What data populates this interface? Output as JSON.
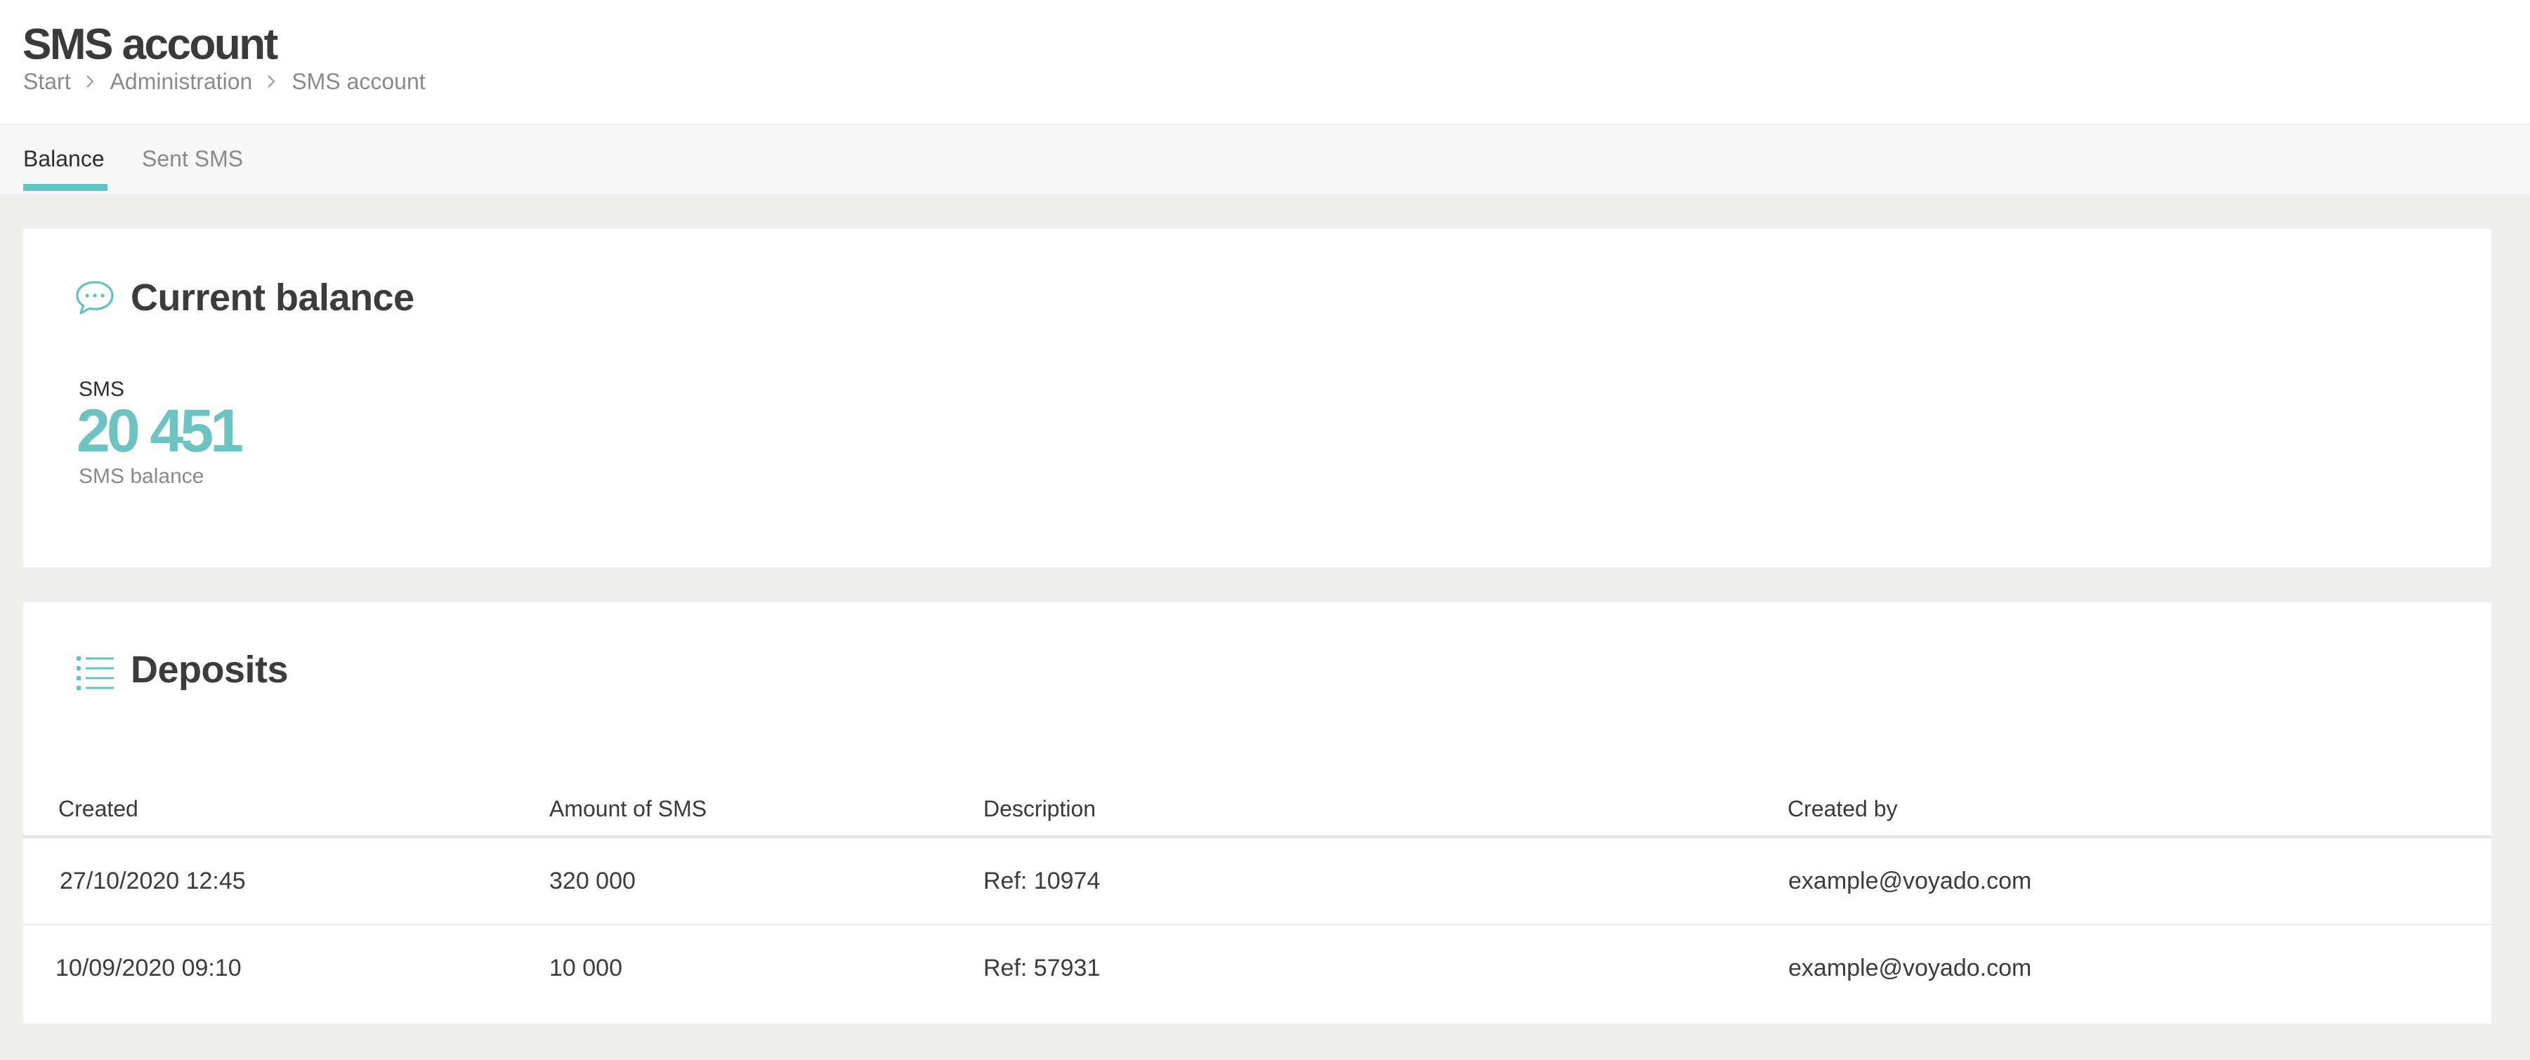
{
  "header": {
    "title": "SMS account",
    "breadcrumb": [
      "Start",
      "Administration",
      "SMS account"
    ]
  },
  "tabs": [
    {
      "label": "Balance",
      "active": true
    },
    {
      "label": "Sent SMS",
      "active": false
    }
  ],
  "balance_card": {
    "title": "Current balance",
    "icon": "chat-bubble-icon",
    "label": "SMS",
    "value": "20 451",
    "sublabel": "SMS balance"
  },
  "deposits_card": {
    "title": "Deposits",
    "icon": "list-icon",
    "columns": [
      "Created",
      "Amount of SMS",
      "Description",
      "Created by"
    ],
    "rows": [
      {
        "created": "27/10/2020 12:45",
        "amount": "320 000",
        "description": "Ref: 10974",
        "created_by": "example@voyado.com"
      },
      {
        "created": "10/09/2020 09:10",
        "amount": "10 000",
        "description": "Ref: 57931",
        "created_by": "example@voyado.com"
      }
    ]
  },
  "colors": {
    "accent": "#5fc4c4",
    "background": "#eeeeed",
    "card": "#ffffff"
  }
}
